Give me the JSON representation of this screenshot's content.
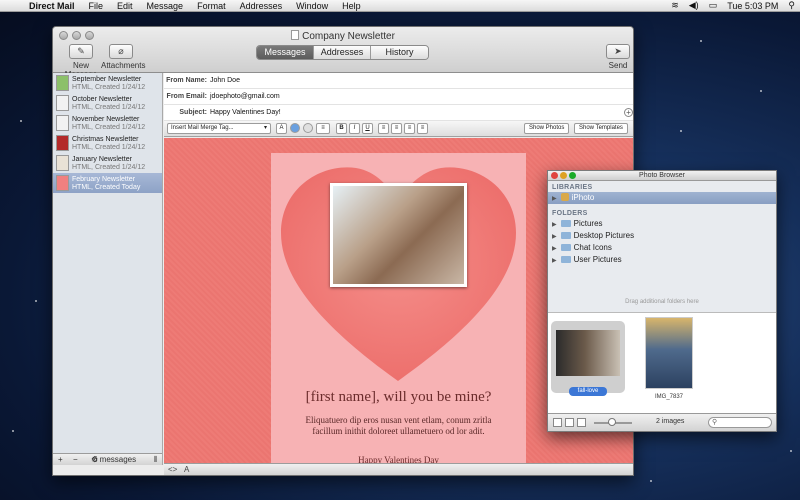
{
  "menubar": {
    "app": "Direct Mail",
    "items": [
      "File",
      "Edit",
      "Message",
      "Format",
      "Addresses",
      "Window",
      "Help"
    ],
    "clock": "Tue 5:03 PM"
  },
  "window": {
    "title": "Company Newsletter",
    "new_message": "New Message",
    "attachments": "Attachments",
    "send": "Send",
    "tabs": [
      "Messages",
      "Addresses",
      "History"
    ]
  },
  "sidebar": {
    "items": [
      {
        "name": "September Newsletter",
        "meta": "HTML, Created 1/24/12",
        "color": "#8cc06a"
      },
      {
        "name": "October Newsletter",
        "meta": "HTML, Created 1/24/12",
        "color": "#f2f2f2"
      },
      {
        "name": "November Newsletter",
        "meta": "HTML, Created 1/24/12",
        "color": "#f2f2f2"
      },
      {
        "name": "Christmas Newsletter",
        "meta": "HTML, Created 1/24/12",
        "color": "#b32a2a"
      },
      {
        "name": "January Newsletter",
        "meta": "HTML, Created 1/24/12",
        "color": "#e9e2d6"
      },
      {
        "name": "February Newsletter",
        "meta": "HTML, Created Today",
        "color": "#f08080"
      }
    ],
    "count": "6 messages"
  },
  "fields": {
    "from_name_label": "From Name:",
    "from_name": "John Doe",
    "from_email_label": "From Email:",
    "from_email": "jdoephoto@gmail.com",
    "subject_label": "Subject:",
    "subject": "Happy Valentines Day!"
  },
  "format_bar": {
    "merge": "Insert Mail Merge Tag...",
    "show_photos": "Show Photos",
    "show_templates": "Show Templates"
  },
  "newsletter": {
    "headline": "[first name], will you be mine?",
    "body": "Eliquatuero dip eros nusan vent etlam, conum zritla facillum inithit doloreet ullametuero od lor adit.",
    "closing": "Happy Valentines Day"
  },
  "photo_browser": {
    "title": "Photo Browser",
    "libraries_label": "LIBRARIES",
    "library": "iPhoto",
    "folders_label": "FOLDERS",
    "folders": [
      "Pictures",
      "Desktop Pictures",
      "Chat Icons",
      "User Pictures"
    ],
    "drag_hint": "Drag additional folders here",
    "photos": [
      "fall-love",
      "IMG_7837"
    ],
    "count": "2 images"
  }
}
